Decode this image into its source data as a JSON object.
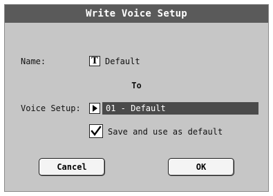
{
  "dialog": {
    "title": "Write Voice Setup",
    "name_label": "Name:",
    "name_value": "Default",
    "to_label": "To",
    "voice_setup_label": "Voice Setup:",
    "voice_setup_value": "01 - Default",
    "checkbox_label": "Save and use as default",
    "checkbox_checked": true,
    "cancel_label": "Cancel",
    "ok_label": "OK"
  },
  "icons": {
    "name_edit": "text-edit-icon",
    "voice_setup_select": "play-arrow-icon",
    "checkbox_mark": "checkmark-icon"
  },
  "colors": {
    "dialog_bg": "#c6c6c6",
    "titlebar_bg": "#5a5a5a",
    "field_bg": "#4a4a4a"
  }
}
